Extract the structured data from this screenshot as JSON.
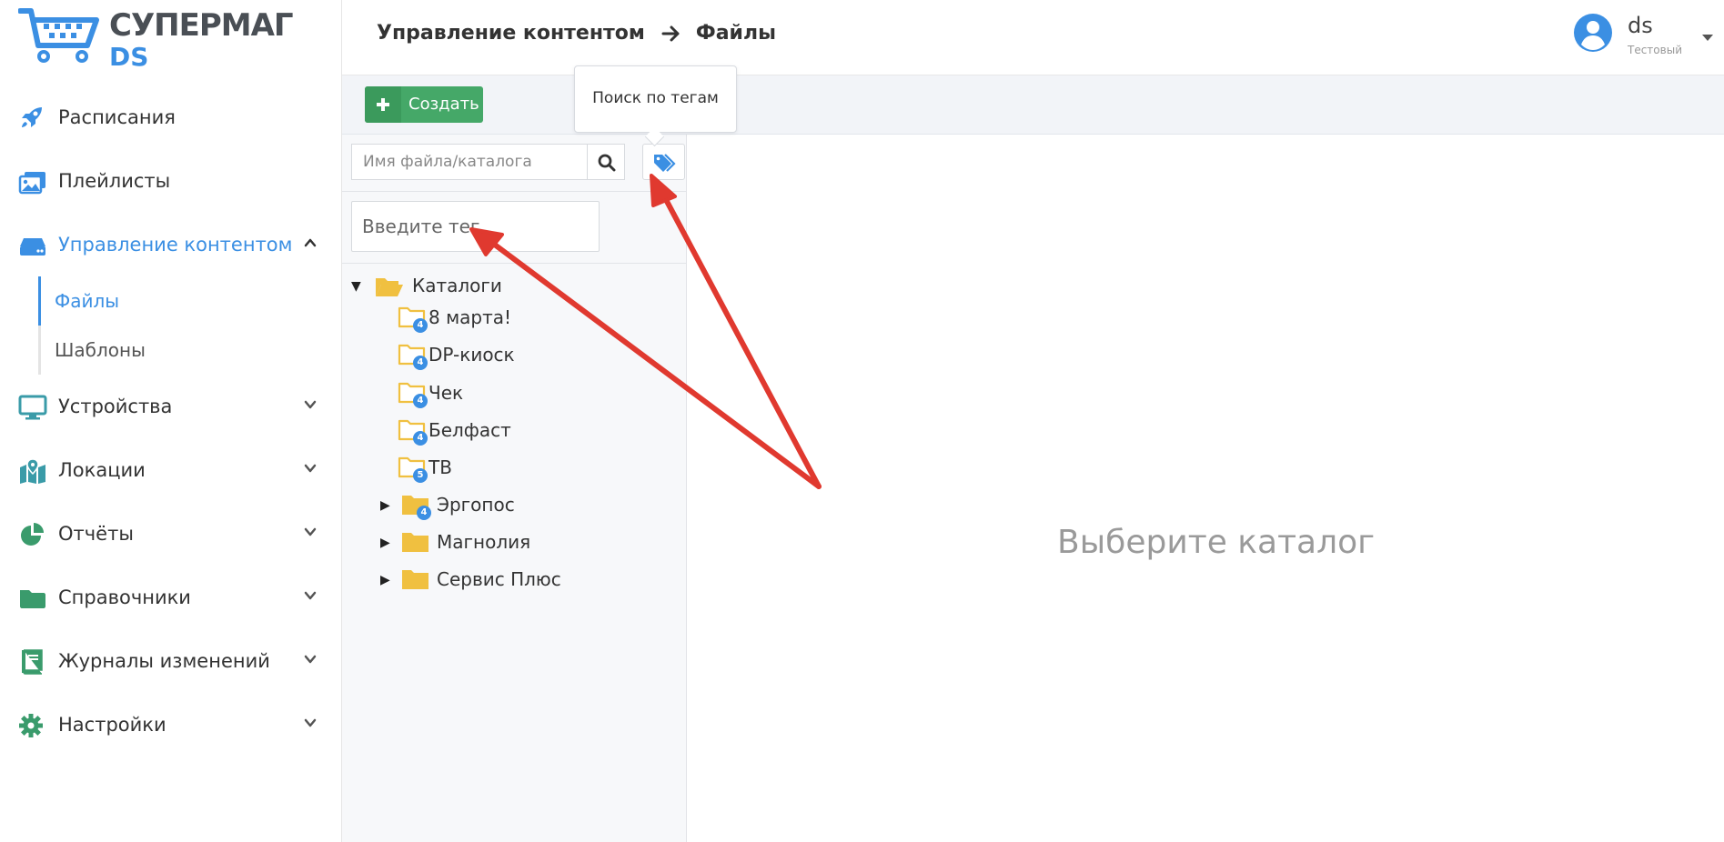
{
  "app": {
    "logo_title": "СУПЕРМАГ",
    "logo_subtitle": "DS"
  },
  "sidebar": {
    "items": [
      {
        "label": "Расписания",
        "icon": "rocket-icon"
      },
      {
        "label": "Плейлисты",
        "icon": "images-icon"
      },
      {
        "label": "Управление контентом",
        "icon": "hdd-icon",
        "active": true,
        "expanded": true
      },
      {
        "label": "Устройства",
        "icon": "monitor-icon"
      },
      {
        "label": "Локации",
        "icon": "map-icon"
      },
      {
        "label": "Отчёты",
        "icon": "pie-chart-icon"
      },
      {
        "label": "Справочники",
        "icon": "folder-icon"
      },
      {
        "label": "Журналы изменений",
        "icon": "book-icon"
      },
      {
        "label": "Настройки",
        "icon": "gear-icon"
      }
    ],
    "submenu": [
      {
        "label": "Файлы",
        "active": true
      },
      {
        "label": "Шаблоны"
      }
    ]
  },
  "header": {
    "breadcrumb": [
      "Управление контентом",
      "Файлы"
    ],
    "user_name": "ds",
    "user_role": "Тестовый"
  },
  "toolbar": {
    "create_label": "Создать",
    "tooltip": "Поиск по тегам"
  },
  "filepanel": {
    "search_placeholder": "Имя файла/каталога",
    "tag_placeholder": "Введите тег",
    "tree": {
      "root": "Каталоги",
      "children": [
        {
          "label": "8 марта!",
          "badge": "4",
          "type": "empty"
        },
        {
          "label": "DP-киоск",
          "badge": "4",
          "type": "empty"
        },
        {
          "label": "Чек",
          "badge": "4",
          "type": "empty"
        },
        {
          "label": "Белфаст",
          "badge": "4",
          "type": "empty"
        },
        {
          "label": "ТВ",
          "badge": "5",
          "type": "empty"
        },
        {
          "label": "Эргопос",
          "badge": "4",
          "type": "collapsed"
        },
        {
          "label": "Магнолия",
          "badge": "",
          "type": "collapsed"
        },
        {
          "label": "Сервис Плюс",
          "badge": "",
          "type": "collapsed"
        }
      ]
    }
  },
  "main": {
    "empty_text": "Выберите каталог"
  },
  "colors": {
    "accent": "#3b8fe3",
    "create_button": "#45a868",
    "folder": "#f0c040",
    "annotation_arrow": "#e0392f"
  }
}
